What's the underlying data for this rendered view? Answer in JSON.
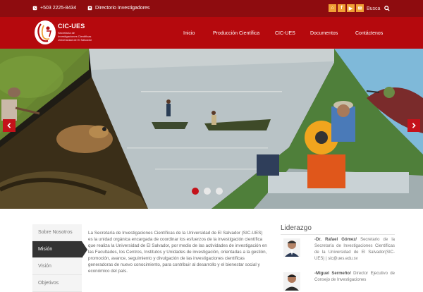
{
  "topbar": {
    "phone": "+503 2225-8434",
    "directory": "Directorio Investigadores",
    "social": [
      {
        "icon": "home-icon",
        "glyph": "⌂"
      },
      {
        "icon": "facebook-icon",
        "glyph": "f"
      },
      {
        "icon": "youtube-icon",
        "glyph": "▶"
      },
      {
        "icon": "email-icon",
        "glyph": "✉"
      }
    ],
    "search_placeholder": "Busca"
  },
  "logo": {
    "brand": "CIC-UES",
    "subtitle": "Secretaría de Investigaciones Científicas Universidad de El Salvador"
  },
  "nav": {
    "items": [
      "Inicio",
      "Producción Científica",
      "CIC-UES",
      "Documentos",
      "Contáctenos"
    ]
  },
  "slider": {
    "active_slide": 1,
    "slide_count": 3
  },
  "about": {
    "tabs": [
      "Sobre Nosotros",
      "Misión",
      "Visión",
      "Objetivos"
    ],
    "active_tab": "Misión",
    "mission_text": "La Secretaría de Investigaciones Científicas de la Universidad de El Salvador (SIC-UES) es la unidad orgánica encargada de coordinar los esfuerzos de la investigación científica que realiza la Universidad de El Salvador, por medio de las actividades de investigación en las Facultades, los Centros, Institutos y Unidades de investigación, orientadas a la gestión, promoción, avance, seguimiento y divulgación de las investigaciones científicas generadoras de nuevo conocimiento, para contribuir al desarrollo y el bienestar social y económico del país."
  },
  "leadership": {
    "title": "Liderazgo",
    "people": [
      {
        "name": "-Dr. Rafael Gómez/",
        "description": "Secretario de la Secretaría de Investigaciones Científicas de la Universidad de El Salvador(SIC-UES) | sic@ues.edu.sv"
      },
      {
        "name": "-Miguel Sermeño/",
        "description": "Director Ejecutivo de Consejo de Investigaciones"
      }
    ]
  },
  "colors": {
    "topbar": "#8e0c0f",
    "nav": "#b5090d",
    "accent": "#c4121a",
    "social": "#f0a035"
  }
}
